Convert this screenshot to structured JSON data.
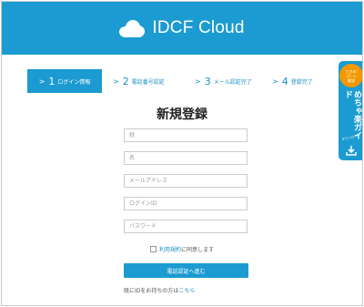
{
  "header": {
    "logo_text": "IDCF Cloud"
  },
  "steps": [
    {
      "num": "1",
      "label": "ログイン情報",
      "active": true
    },
    {
      "num": "2",
      "label": "電話番号認証",
      "active": false
    },
    {
      "num": "3",
      "label": "メール認証完了",
      "active": false
    },
    {
      "num": "4",
      "label": "登録完了",
      "active": false
    }
  ],
  "form": {
    "title": "新規登録",
    "fields": {
      "last_name": {
        "value": "",
        "placeholder": "姓"
      },
      "first_name": {
        "value": "",
        "placeholder": "名"
      },
      "email": {
        "value": "",
        "placeholder": "メールアドレス"
      },
      "login_id": {
        "value": "",
        "placeholder": "ログインID"
      },
      "password": {
        "value": "",
        "placeholder": "パスワード"
      }
    },
    "agree": {
      "link_text": "利用規約",
      "suffix": "に同意します",
      "checked": false
    },
    "submit_label": "電話認証へ進む",
    "login_prompt": "既にIDをお持ちの方は",
    "login_link": "こちら"
  },
  "banner": {
    "badge_line1": "できる!",
    "badge_line2": "ゴーン",
    "badge_line3": "解説",
    "title": "めちゃ楽ガイド",
    "download": "ダウンロード"
  },
  "colors": {
    "brand": "#1b9bd1",
    "badge": "#f39800",
    "link": "#1b8fc4"
  }
}
